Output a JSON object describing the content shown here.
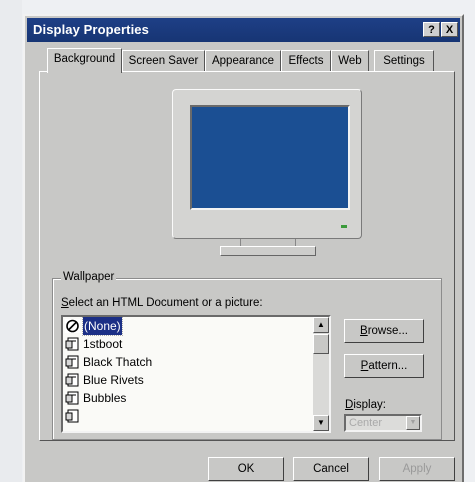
{
  "window": {
    "title": "Display Properties"
  },
  "titlebar": {
    "help_label": "?",
    "close_label": "X"
  },
  "tabs": [
    {
      "label": "Background",
      "active": true
    },
    {
      "label": "Screen Saver",
      "active": false
    },
    {
      "label": "Appearance",
      "active": false
    },
    {
      "label": "Effects",
      "active": false
    },
    {
      "label": "Web",
      "active": false
    },
    {
      "label": "Settings",
      "active": false
    }
  ],
  "wallpaper": {
    "group_title": "Wallpaper",
    "instruction_prefix": "S",
    "instruction_rest": "elect an HTML Document or a picture:",
    "items": [
      {
        "label": "(None)",
        "icon": "none-icon",
        "selected": true
      },
      {
        "label": "1stboot",
        "icon": "bitmap-icon",
        "selected": false
      },
      {
        "label": "Black Thatch",
        "icon": "bitmap-icon",
        "selected": false
      },
      {
        "label": "Blue Rivets",
        "icon": "bitmap-icon",
        "selected": false
      },
      {
        "label": "Bubbles",
        "icon": "bitmap-icon",
        "selected": false
      }
    ],
    "browse_prefix": "B",
    "browse_rest": "rowse...",
    "pattern_prefix": "P",
    "pattern_rest": "attern...",
    "display_prefix": "D",
    "display_rest": "isplay:",
    "display_value": "Center"
  },
  "footer": {
    "ok_label": "OK",
    "cancel_label": "Cancel",
    "apply_label": "Apply"
  },
  "colors": {
    "titlebar": "#1b3a7e",
    "selection": "#1b2f86",
    "screen": "#1b4f93",
    "face": "#c8c8c6"
  }
}
